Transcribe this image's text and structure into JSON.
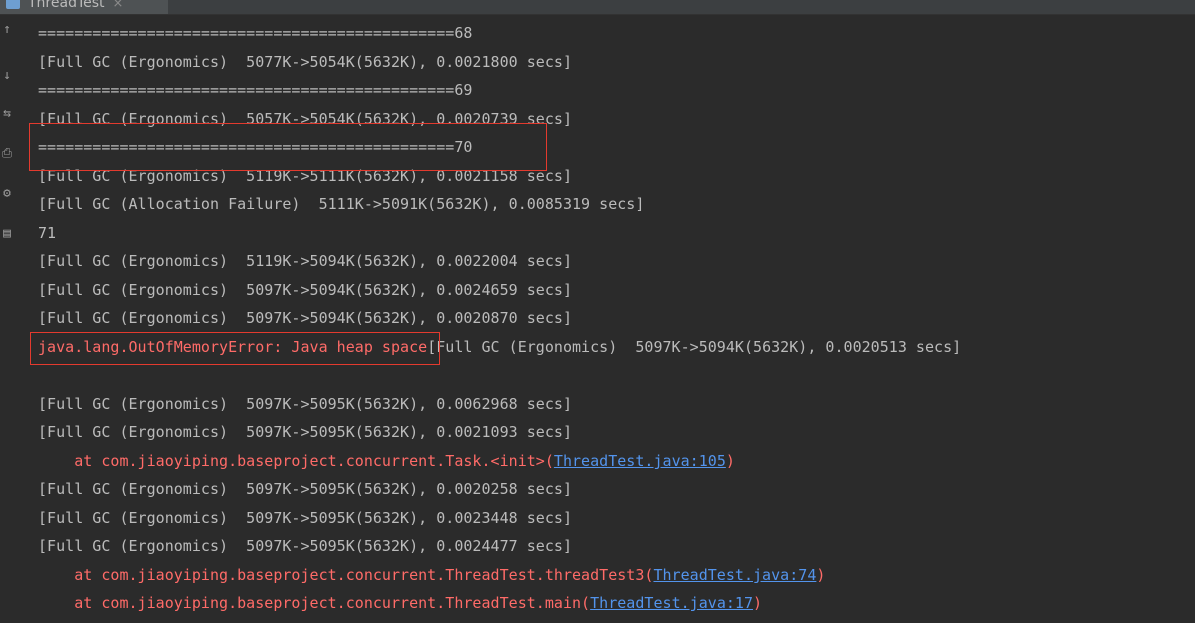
{
  "tab": {
    "title": "ThreadTest",
    "close": "×"
  },
  "gutter": {
    "icons": [
      "↑",
      "↓",
      "⇆",
      "⎙",
      "⚙",
      "▤"
    ]
  },
  "colors": {
    "background": "#2b2b2b",
    "text": "#bbbbbb",
    "error": "#ff6b68",
    "link": "#5394ec",
    "highlight_box": "#e33a2e"
  },
  "console": {
    "lines": [
      {
        "text": "==============================================68"
      },
      {
        "text": "[Full GC (Ergonomics)  5077K->5054K(5632K), 0.0021800 secs]"
      },
      {
        "text": "==============================================69"
      },
      {
        "text": "[Full GC (Ergonomics)  5057K->5054K(5632K), 0.0020739 secs]"
      },
      {
        "text": "==============================================70"
      },
      {
        "text": "[Full GC (Ergonomics)  5119K->5111K(5632K), 0.0021158 secs]"
      },
      {
        "text": "[Full GC (Allocation Failure)  5111K->5091K(5632K), 0.0085319 secs]"
      },
      {
        "text": "71"
      },
      {
        "text": "[Full GC (Ergonomics)  5119K->5094K(5632K), 0.0022004 secs]"
      },
      {
        "text": "[Full GC (Ergonomics)  5097K->5094K(5632K), 0.0024659 secs]"
      },
      {
        "text": "[Full GC (Ergonomics)  5097K->5094K(5632K), 0.0020870 secs]"
      },
      {
        "error": "java.lang.OutOfMemoryError: Java heap space",
        "text": "[Full GC (Ergonomics)  5097K->5094K(5632K), 0.0020513 secs]"
      },
      {
        "text": ""
      },
      {
        "text": "[Full GC (Ergonomics)  5097K->5095K(5632K), 0.0062968 secs]"
      },
      {
        "text": "[Full GC (Ergonomics)  5097K->5095K(5632K), 0.0021093 secs]"
      },
      {
        "error": "    at com.jiaoyiping.baseproject.concurrent.Task.<init>(",
        "link": "ThreadTest.java:105",
        "error_after": ")"
      },
      {
        "text": "[Full GC (Ergonomics)  5097K->5095K(5632K), 0.0020258 secs]"
      },
      {
        "text": "[Full GC (Ergonomics)  5097K->5095K(5632K), 0.0023448 secs]"
      },
      {
        "text": "[Full GC (Ergonomics)  5097K->5095K(5632K), 0.0024477 secs]"
      },
      {
        "error": "    at com.jiaoyiping.baseproject.concurrent.ThreadTest.threadTest3(",
        "link": "ThreadTest.java:74",
        "error_after": ")"
      },
      {
        "error": "    at com.jiaoyiping.baseproject.concurrent.ThreadTest.main(",
        "link": "ThreadTest.java:17",
        "error_after": ")"
      }
    ]
  }
}
